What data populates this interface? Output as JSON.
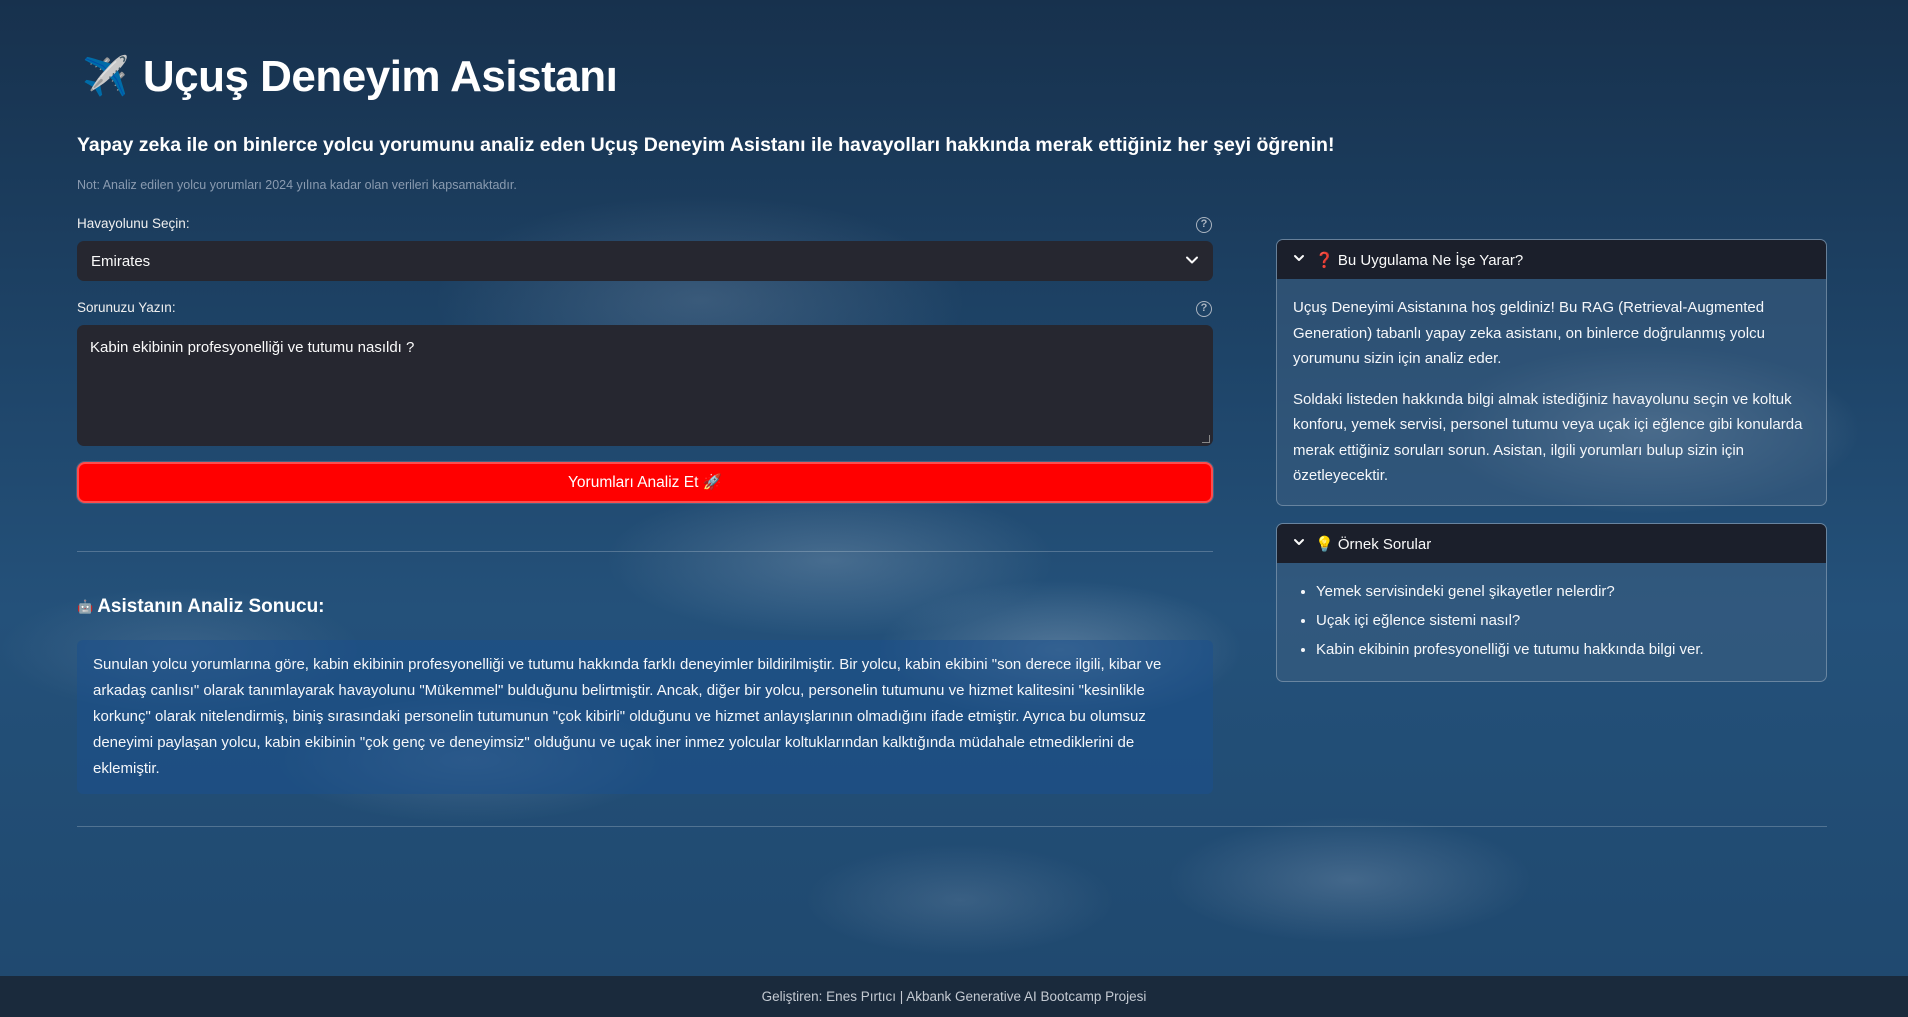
{
  "header": {
    "icon": "airplane-icon",
    "title": "Uçuş Deneyim Asistanı",
    "subtitle": "Yapay zeka ile on binlerce yolcu yorumunu analiz eden Uçuş Deneyim Asistanı ile havayolları hakkında merak ettiğiniz her şeyi öğrenin!",
    "note": "Not: Analiz edilen yolcu yorumları 2024 yılına kadar olan verileri kapsamaktadır."
  },
  "form": {
    "airline_label": "Havayolunu Seçin:",
    "airline_value": "Emirates",
    "question_label": "Sorunuzu Yazın:",
    "question_value": "Kabin ekibinin profesyonelliği ve tutumu nasıldı ?",
    "analyze_button": "Yorumları Analiz Et 🚀"
  },
  "result": {
    "title": "Asistanın Analiz Sonucu:",
    "text": "Sunulan yolcu yorumlarına göre, kabin ekibinin profesyonelliği ve tutumu hakkında farklı deneyimler bildirilmiştir. Bir yolcu, kabin ekibini \"son derece ilgili, kibar ve arkadaş canlısı\" olarak tanımlayarak havayolunu \"Mükemmel\" bulduğunu belirtmiştir. Ancak, diğer bir yolcu, personelin tutumunu ve hizmet kalitesini \"kesinlikle korkunç\" olarak nitelendirmiş, biniş sırasındaki personelin tutumunun \"çok kibirli\" olduğunu ve hizmet anlayışlarının olmadığını ifade etmiştir. Ayrıca bu olumsuz deneyimi paylaşan yolcu, kabin ekibinin \"çok genç ve deneyimsiz\" olduğunu ve uçak iner inmez yolcular koltuklarından kalktığında müdahale etmediklerini de eklemiştir."
  },
  "about": {
    "title": "❓ Bu Uygulama Ne İşe Yarar?",
    "paragraphs": [
      "Uçuş Deneyimi Asistanına hoş geldiniz! Bu RAG (Retrieval-Augmented Generation) tabanlı yapay zeka asistanı, on binlerce doğrulanmış yolcu yorumunu sizin için analiz eder.",
      "Soldaki listeden hakkında bilgi almak istediğiniz havayolunu seçin ve koltuk konforu, yemek servisi, personel tutumu veya uçak içi eğlence gibi konularda merak ettiğiniz soruları sorun. Asistan, ilgili yorumları bulup sizin için özetleyecektir."
    ]
  },
  "examples": {
    "title": "💡 Örnek Sorular",
    "items": [
      "Yemek servisindeki genel şikayetler nelerdir?",
      "Uçak içi eğlence sistemi nasıl?",
      "Kabin ekibinin profesyonelliği ve tutumu hakkında bilgi ver."
    ]
  },
  "footer": {
    "text": "Geliştiren: Enes Pırtıcı | Akbank Generative AI Bootcamp Projesi"
  },
  "colors": {
    "accent_button": "#ff0000",
    "input_bg": "#262730",
    "expander_header": "#1b1f2b"
  }
}
